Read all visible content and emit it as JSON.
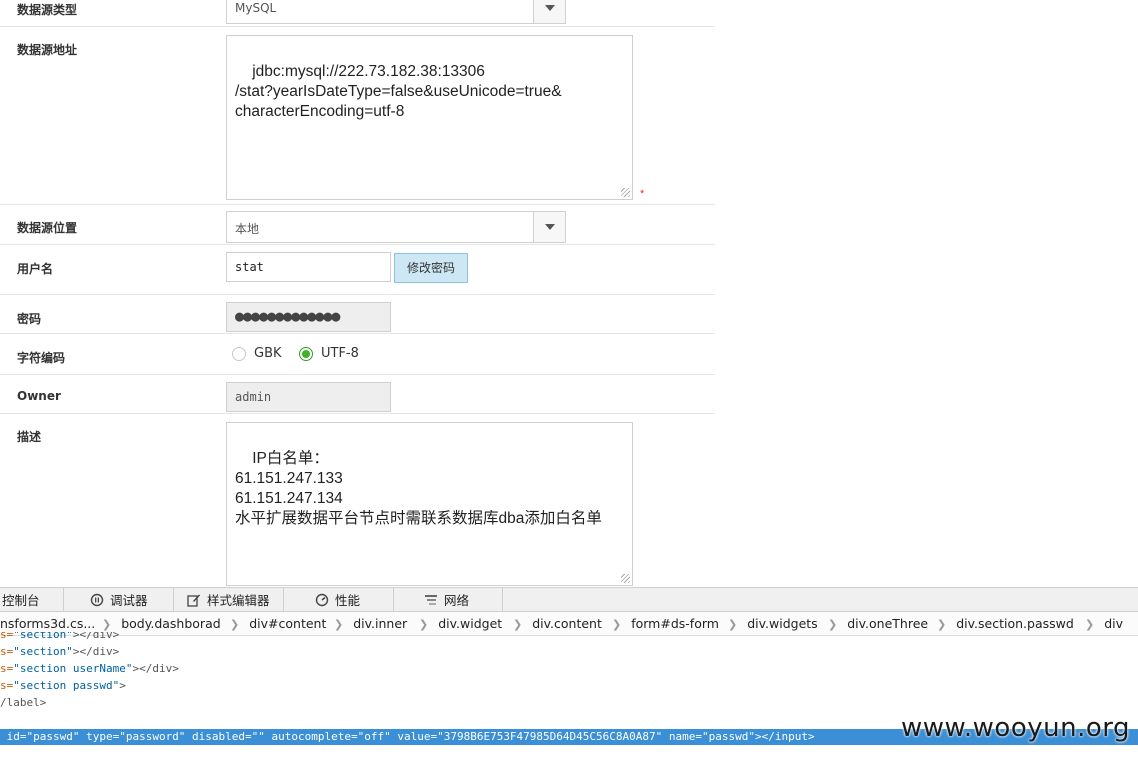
{
  "form": {
    "type_label": "数据源类型",
    "type_value": "MySQL",
    "url_label": "数据源地址",
    "url_value": "jdbc:mysql://222.73.182.38:13306\n/stat?yearIsDateType=false&useUnicode=true&\ncharacterEncoding=utf-8",
    "required_mark": "*",
    "location_label": "数据源位置",
    "location_value": "本地",
    "username_label": "用户名",
    "username_value": "stat",
    "change_password_button": "修改密码",
    "password_label": "密码",
    "password_value": "●●●●●●●●●●●●●",
    "encoding_label": "字符编码",
    "encoding_options": [
      {
        "label": "GBK",
        "checked": false
      },
      {
        "label": "UTF-8",
        "checked": true
      }
    ],
    "owner_label": "Owner",
    "owner_value": "admin",
    "desc_label": "描述",
    "desc_value": "IP白名单：\n61.151.247.133\n61.151.247.134\n水平扩展数据平台节点时需联系数据库dba添加白名单"
  },
  "devtools": {
    "tabs": [
      {
        "label": "控制台",
        "icon": "console-icon"
      },
      {
        "label": "调试器",
        "icon": "debugger-icon"
      },
      {
        "label": "样式编辑器",
        "icon": "style-editor-icon"
      },
      {
        "label": "性能",
        "icon": "performance-icon"
      },
      {
        "label": "网络",
        "icon": "network-icon"
      }
    ],
    "breadcrumbs": [
      "nsforms3d.cs...",
      "body.dashborad",
      "div#content",
      "div.inner",
      "div.widget",
      "div.content",
      "form#ds-form",
      "div.widgets",
      "div.oneThree",
      "div.section.passwd",
      "div"
    ],
    "code_lines": [
      {
        "prefix": "s=",
        "value": "\"section\"",
        "suffix": "></div>"
      },
      {
        "prefix": "s=",
        "value": "\"section\"",
        "suffix": "></div>"
      },
      {
        "prefix": "s=",
        "value": "\"section userName\"",
        "suffix": "></div>"
      },
      {
        "prefix": "s=",
        "value": "\"section passwd\"",
        "suffix": ">"
      },
      {
        "prefix": "",
        "value": "",
        "suffix": "/label>"
      }
    ],
    "selected_line": " id=\"passwd\" type=\"password\" disabled=\"\" autocomplete=\"off\" value=\"3798B6E753F47985D64D45C56C8A0A87\" name=\"passwd\"></input>"
  },
  "watermark": "www.wooyun.org",
  "colors": {
    "accent_button": "#cde8f4",
    "radio_checked": "#3fb227",
    "selection": "#3a8fd6",
    "required": "#dd3333"
  }
}
